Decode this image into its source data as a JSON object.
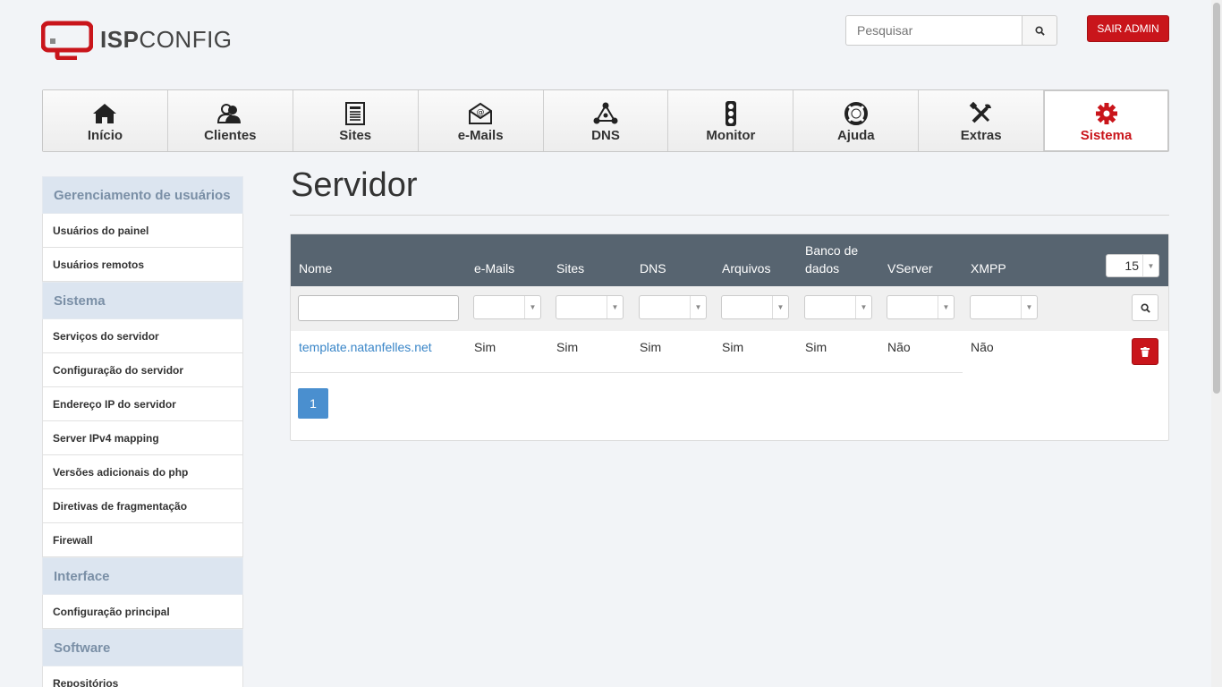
{
  "header": {
    "logo_isp": "ISP",
    "logo_config": "CONFIG",
    "search_placeholder": "Pesquisar",
    "logout_label": "SAIR ADMIN"
  },
  "nav": {
    "items": [
      {
        "label": "Início",
        "icon": "home-icon"
      },
      {
        "label": "Clientes",
        "icon": "users-icon"
      },
      {
        "label": "Sites",
        "icon": "document-icon"
      },
      {
        "label": "e-Mails",
        "icon": "envelope-icon"
      },
      {
        "label": "DNS",
        "icon": "network-icon"
      },
      {
        "label": "Monitor",
        "icon": "traffic-light-icon"
      },
      {
        "label": "Ajuda",
        "icon": "lifebuoy-icon"
      },
      {
        "label": "Extras",
        "icon": "tools-icon"
      },
      {
        "label": "Sistema",
        "icon": "gear-icon",
        "active": true
      }
    ]
  },
  "sidebar": {
    "sections": [
      {
        "title": "Gerenciamento de usuários",
        "items": [
          "Usuários do painel",
          "Usuários remotos"
        ]
      },
      {
        "title": "Sistema",
        "items": [
          "Serviços do servidor",
          "Configuração do servidor",
          "Endereço IP do servidor",
          "Server IPv4 mapping",
          "Versões adicionais do php",
          "Diretivas de fragmentação",
          "Firewall"
        ]
      },
      {
        "title": "Interface",
        "items": [
          "Configuração principal"
        ]
      },
      {
        "title": "Software",
        "items": [
          "Repositórios"
        ]
      }
    ]
  },
  "main": {
    "title": "Servidor",
    "columns": [
      "Nome",
      "e-Mails",
      "Sites",
      "DNS",
      "Arquivos",
      "Banco de dados",
      "VServer",
      "XMPP"
    ],
    "per_page": "15",
    "rows": [
      [
        "template.natanfelles.net",
        "Sim",
        "Sim",
        "Sim",
        "Sim",
        "Sim",
        "Não",
        "Não"
      ]
    ],
    "pagination": [
      "1"
    ]
  },
  "colors": {
    "brand_red": "#c9151b",
    "table_header": "#576470",
    "sidebar_header": "#dce5f0",
    "link": "#3a86c8",
    "page_button": "#4a8fcf"
  }
}
